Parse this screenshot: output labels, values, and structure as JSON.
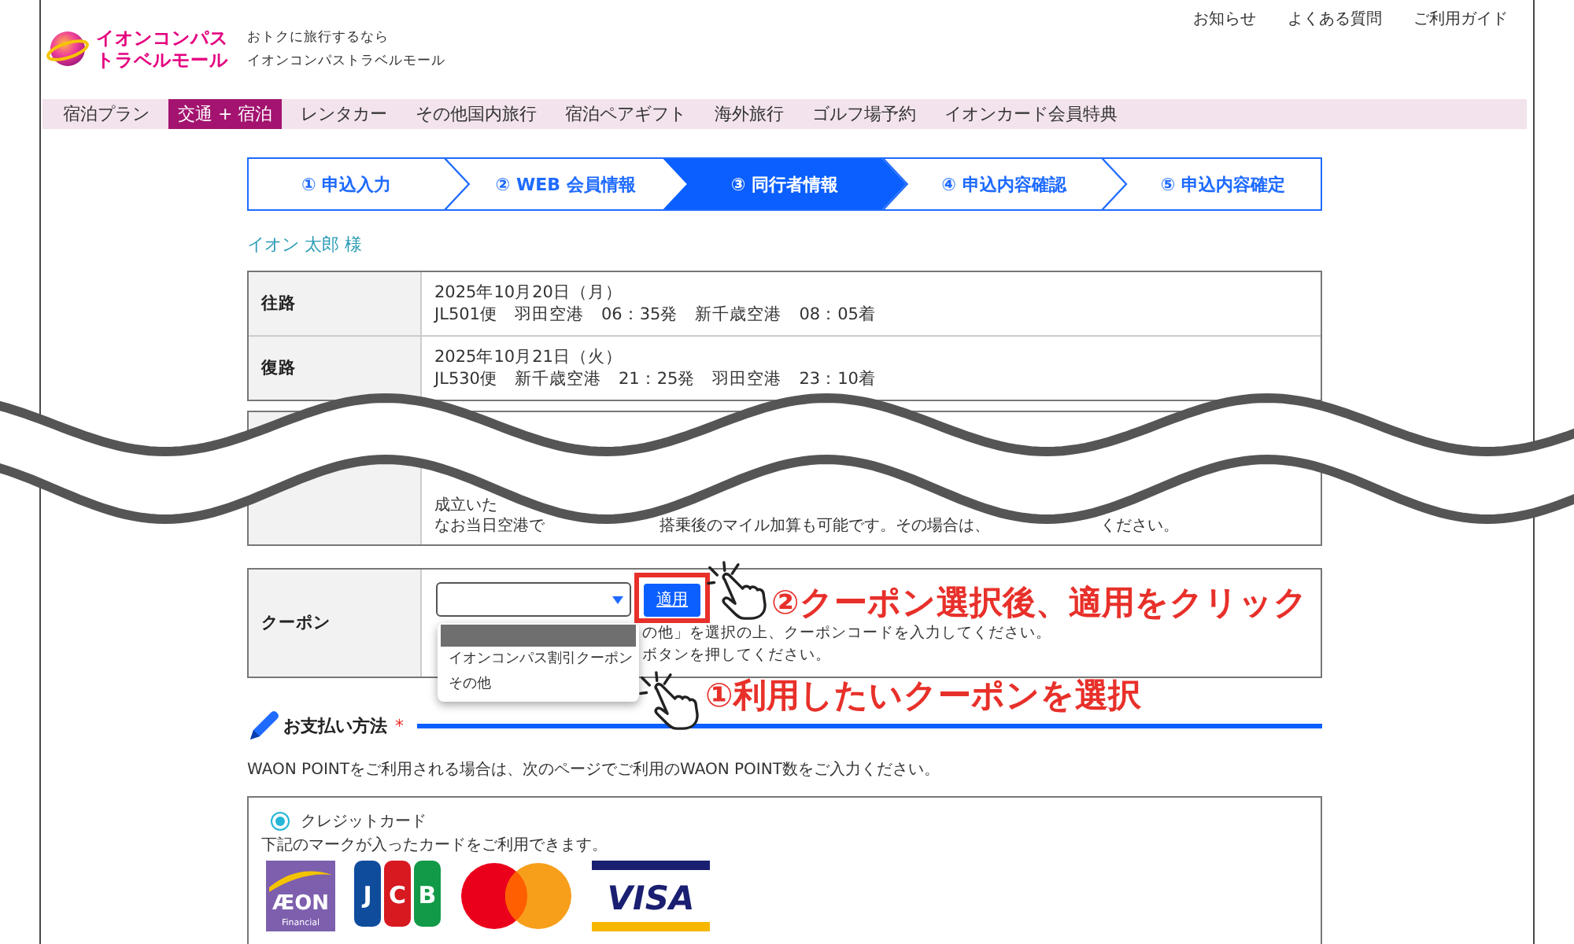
{
  "header": {
    "logo_lines": [
      "イオンコンパス",
      "トラベルモール"
    ],
    "tagline_lines": [
      "おトクに旅行するなら",
      "イオンコンパストラベルモール"
    ],
    "links": [
      "お知らせ",
      "よくある質問",
      "ご利用ガイド"
    ]
  },
  "nav": [
    {
      "label": "宿泊プラン",
      "selected": false
    },
    {
      "label": "交通 + 宿泊",
      "selected": true
    },
    {
      "label": "レンタカー",
      "selected": false
    },
    {
      "label": "その他国内旅行",
      "selected": false
    },
    {
      "label": "宿泊ペアギフト",
      "selected": false
    },
    {
      "label": "海外旅行",
      "selected": false
    },
    {
      "label": "ゴルフ場予約",
      "selected": false
    },
    {
      "label": "イオンカード会員特典",
      "selected": false
    }
  ],
  "steps": [
    {
      "label": "① 申込入力",
      "selected": false
    },
    {
      "label": "② WEB 会員情報",
      "selected": false
    },
    {
      "label": "③ 同行者情報",
      "selected": true
    },
    {
      "label": "④ 申込内容確認",
      "selected": false
    },
    {
      "label": "⑤ 申込内容確定",
      "selected": false
    }
  ],
  "customer_name": "イオン 太郎 様",
  "itinerary": [
    {
      "label": "往路",
      "lines": [
        "2025年10月20日（月）",
        "JL501便　羽田空港　06：35発　新千歳空港　08：05着"
      ]
    },
    {
      "label": "復路",
      "lines": [
        "2025年10月21日（火）",
        "JL530便　新千歳空港　21：25発　羽田空港　23：10着"
      ]
    }
  ],
  "cut_row": {
    "lines": [
      [
        "成立いた"
      ],
      [
        "なお当日空港で",
        "搭乗後のマイル加算も可能です。その場合は、",
        "ください。"
      ]
    ]
  },
  "coupon": {
    "label": "クーポン",
    "apply_button": {
      "label": "適用",
      "highlighted": true
    },
    "help_lines": [
      "の他」を選択の上、クーポンコードを入力してください。",
      "ボタンを押してください。"
    ],
    "options": [
      {
        "kind": "blank",
        "selected": true
      },
      {
        "kind": "text",
        "label": "イオンコンパス割引クーポン",
        "selected": false
      },
      {
        "kind": "text",
        "label": "その他",
        "selected": false
      }
    ],
    "annotations": [
      "②クーポン選択後、適用をクリック",
      "①利用したいクーポンを選択"
    ]
  },
  "payment": {
    "title": "お支払い方法",
    "required_mark": "*",
    "note": "WAON POINTをご利用される場合は、次のページでご利用のWAON POINT数をご入力ください。",
    "methods": [
      {
        "label": "クレジットカード",
        "selected": true,
        "description": "下記のマークが入ったカードをご利用できます。",
        "cards": [
          {
            "kind": "aeon",
            "text": "ÆON",
            "subtext": "Financial"
          },
          {
            "kind": "jcb",
            "text": "JCB"
          },
          {
            "kind": "mastercard"
          },
          {
            "kind": "visa",
            "text": "VISA"
          }
        ]
      }
    ]
  }
}
